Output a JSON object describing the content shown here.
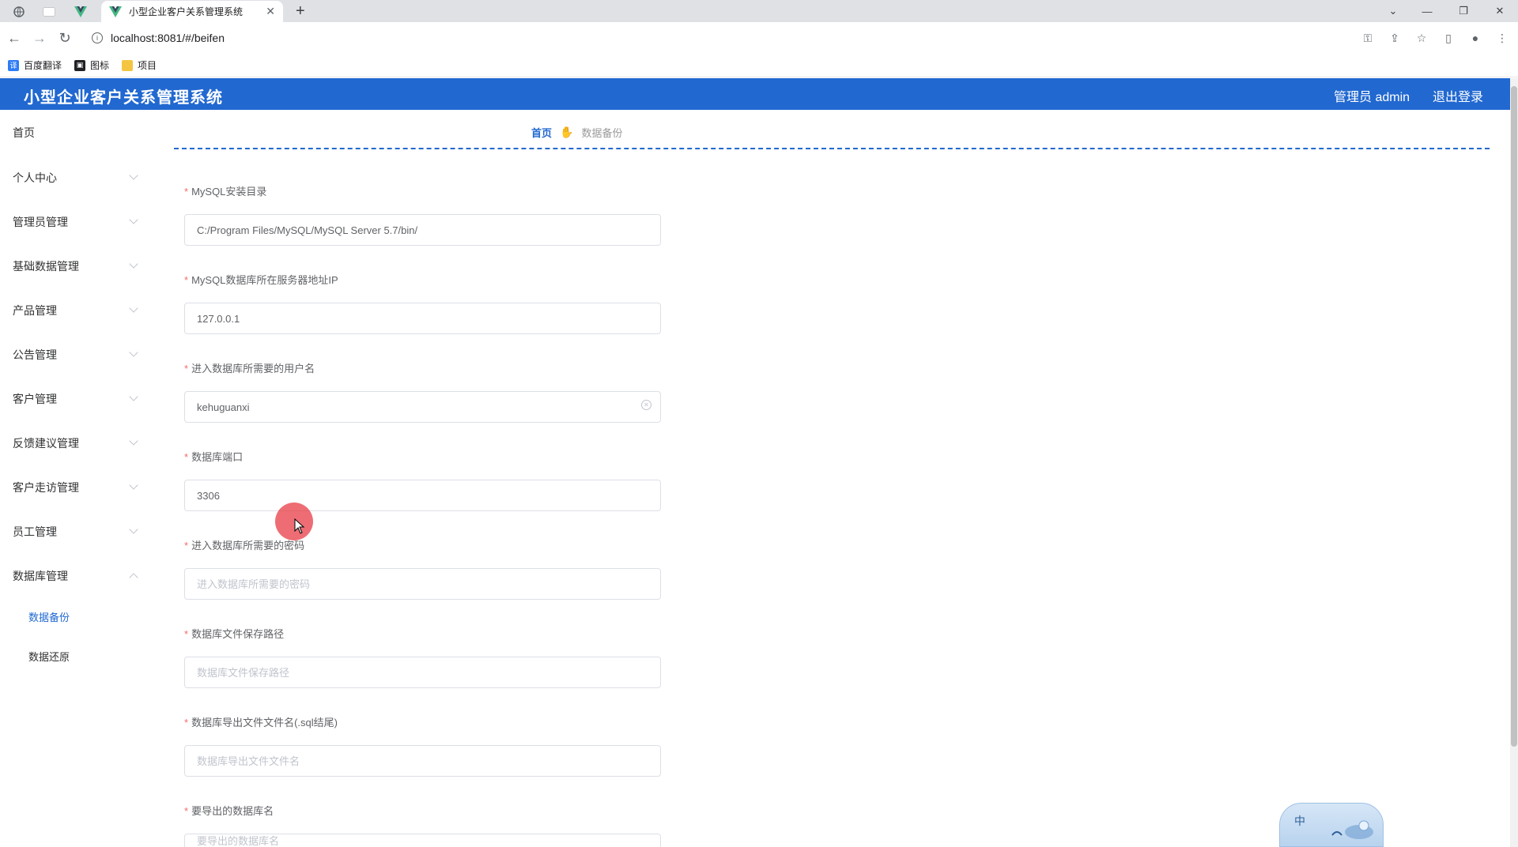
{
  "browser": {
    "tab_title": "小型企业客户关系管理系统",
    "url": "localhost:8081/#/beifen",
    "bookmarks": [
      {
        "label": "百度翻译",
        "icon": "translate-icon",
        "color": "#2e7cf6"
      },
      {
        "label": "图标",
        "icon": "image-icon",
        "color": "#202124"
      },
      {
        "label": "项目",
        "icon": "folder-icon",
        "color": "#f4c542"
      }
    ]
  },
  "header": {
    "title": "小型企业客户关系管理系统",
    "user": "管理员 admin",
    "logout": "退出登录",
    "bg_color": "#2168d0"
  },
  "sidebar": {
    "items": [
      {
        "label": "首页"
      },
      {
        "label": "个人中心"
      },
      {
        "label": "管理员管理"
      },
      {
        "label": "基础数据管理"
      },
      {
        "label": "产品管理"
      },
      {
        "label": "公告管理"
      },
      {
        "label": "客户管理"
      },
      {
        "label": "反馈建议管理"
      },
      {
        "label": "客户走访管理"
      },
      {
        "label": "员工管理"
      },
      {
        "label": "数据库管理"
      }
    ],
    "sub_items": [
      {
        "label": "数据备份",
        "active": true
      },
      {
        "label": "数据还原",
        "active": false
      }
    ]
  },
  "breadcrumb": {
    "home": "首页",
    "current": "数据备份"
  },
  "form": {
    "fields": [
      {
        "label": "MySQL安装目录",
        "value": "C:/Program Files/MySQL/MySQL Server 5.7/bin/",
        "placeholder": ""
      },
      {
        "label": "MySQL数据库所在服务器地址IP",
        "value": "127.0.0.1",
        "placeholder": ""
      },
      {
        "label": "进入数据库所需要的用户名",
        "value": "kehuguanxi",
        "placeholder": ""
      },
      {
        "label": "数据库端口",
        "value": "3306",
        "placeholder": ""
      },
      {
        "label": "进入数据库所需要的密码",
        "value": "",
        "placeholder": "进入数据库所需要的密码"
      },
      {
        "label": "数据库文件保存路径",
        "value": "",
        "placeholder": "数据库文件保存路径"
      },
      {
        "label": "数据库导出文件文件名(.sql结尾)",
        "value": "",
        "placeholder": "数据库导出文件文件名"
      },
      {
        "label": "要导出的数据库名",
        "value": "",
        "placeholder": "要导出的数据库名"
      }
    ]
  },
  "ime": {
    "char": "中"
  }
}
